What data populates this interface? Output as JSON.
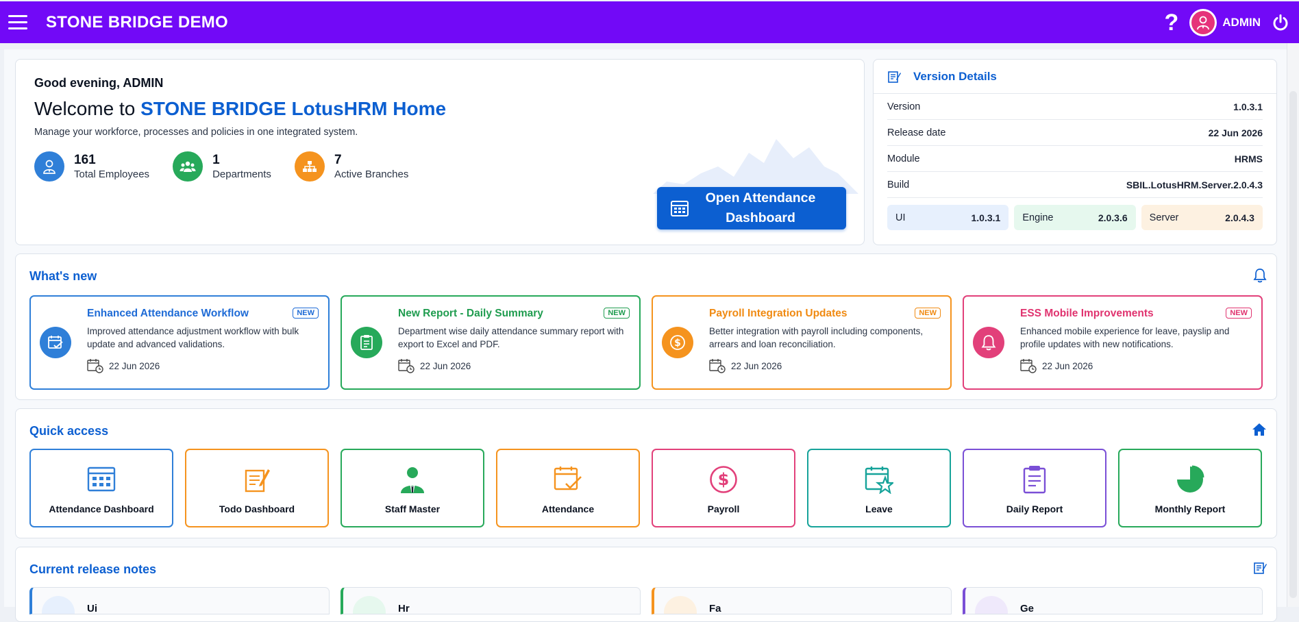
{
  "app": {
    "title": "STONE BRIDGE DEMO",
    "user": "ADMIN",
    "help": "?"
  },
  "hero": {
    "greeting": "Good evening, ADMIN",
    "welcome_prefix": "Welcome to ",
    "welcome_brand": "STONE BRIDGE LotusHRM Home",
    "tagline": "Manage your workforce, processes and policies in one integrated system.",
    "stats": [
      {
        "value": "161",
        "label": "Total Employees",
        "color": "#2f7fd8",
        "icon": "employee-icon"
      },
      {
        "value": "1",
        "label": "Departments",
        "color": "#27a95a",
        "icon": "group-icon"
      },
      {
        "value": "7",
        "label": "Active Branches",
        "color": "#f5931e",
        "icon": "branches-icon"
      }
    ],
    "open_button": "Open Attendance Dashboard"
  },
  "version": {
    "title": "Version Details",
    "rows": [
      {
        "label": "Version",
        "value": "1.0.3.1"
      },
      {
        "label": "Release date",
        "value": "22 Jun 2026"
      },
      {
        "label": "Module",
        "value": "HRMS"
      },
      {
        "label": "Build",
        "value": "SBIL.LotusHRM.Server.2.0.4.3"
      }
    ],
    "chips": [
      {
        "label": "UI",
        "value": "1.0.3.1",
        "bg": "#e7f0fd"
      },
      {
        "label": "Engine",
        "value": "2.0.3.6",
        "bg": "#e6f8ee"
      },
      {
        "label": "Server",
        "value": "2.0.4.3",
        "bg": "#fdf1e1"
      }
    ]
  },
  "whats_new": {
    "title": "What's new",
    "items": [
      {
        "title": "Enhanced Attendance Workflow",
        "badge": "NEW",
        "desc": "Improved attendance adjustment workflow with bulk update and advanced validations.",
        "date": "22 Jun 2026",
        "color": "#2f7fd8",
        "title_color": "#1e6bd6",
        "icon": "calendar-check-icon"
      },
      {
        "title": "New Report - Daily Summary",
        "badge": "NEW",
        "desc": "Department wise daily attendance summary report with export to Excel and PDF.",
        "date": "22 Jun 2026",
        "color": "#27a95a",
        "title_color": "#1f9c4f",
        "icon": "clipboard-icon"
      },
      {
        "title": "Payroll Integration Updates",
        "badge": "NEW",
        "desc": "Better integration with payroll including components, arrears and loan reconciliation.",
        "date": "22 Jun 2026",
        "color": "#f5931e",
        "title_color": "#f08a12",
        "icon": "dollar-icon"
      },
      {
        "title": "ESS Mobile Improvements",
        "badge": "NEW",
        "desc": "Enhanced mobile experience for leave, payslip and profile updates with new notifications.",
        "date": "22 Jun 2026",
        "color": "#e2407a",
        "title_color": "#e0336f",
        "icon": "bell-icon"
      }
    ]
  },
  "quick_access": {
    "title": "Quick access",
    "items": [
      {
        "label": "Attendance Dashboard",
        "color": "#2f7fd8",
        "icon": "calendar-grid-icon"
      },
      {
        "label": "Todo Dashboard",
        "color": "#f5931e",
        "icon": "note-edit-icon"
      },
      {
        "label": "Staff Master",
        "color": "#27a95a",
        "icon": "staff-icon"
      },
      {
        "label": "Attendance",
        "color": "#f5931e",
        "icon": "calendar-check-icon"
      },
      {
        "label": "Payroll",
        "color": "#e2407a",
        "icon": "dollar-icon"
      },
      {
        "label": "Leave",
        "color": "#16a39a",
        "icon": "calendar-star-icon"
      },
      {
        "label": "Daily Report",
        "color": "#7a4fd6",
        "icon": "clipboard-icon"
      },
      {
        "label": "Monthly Report",
        "color": "#27a95a",
        "icon": "pie-chart-icon"
      }
    ]
  },
  "release_notes": {
    "title": "Current release notes",
    "items": [
      {
        "text": "Ui",
        "color": "#2f7fd8",
        "bg": "#e7f0fd"
      },
      {
        "text": "Hr",
        "color": "#27a95a",
        "bg": "#e6f8ee"
      },
      {
        "text": "Fa",
        "color": "#f5931e",
        "bg": "#fdf1e1"
      },
      {
        "text": "Ge",
        "color": "#7a4fd6",
        "bg": "#efe9fb"
      }
    ]
  }
}
